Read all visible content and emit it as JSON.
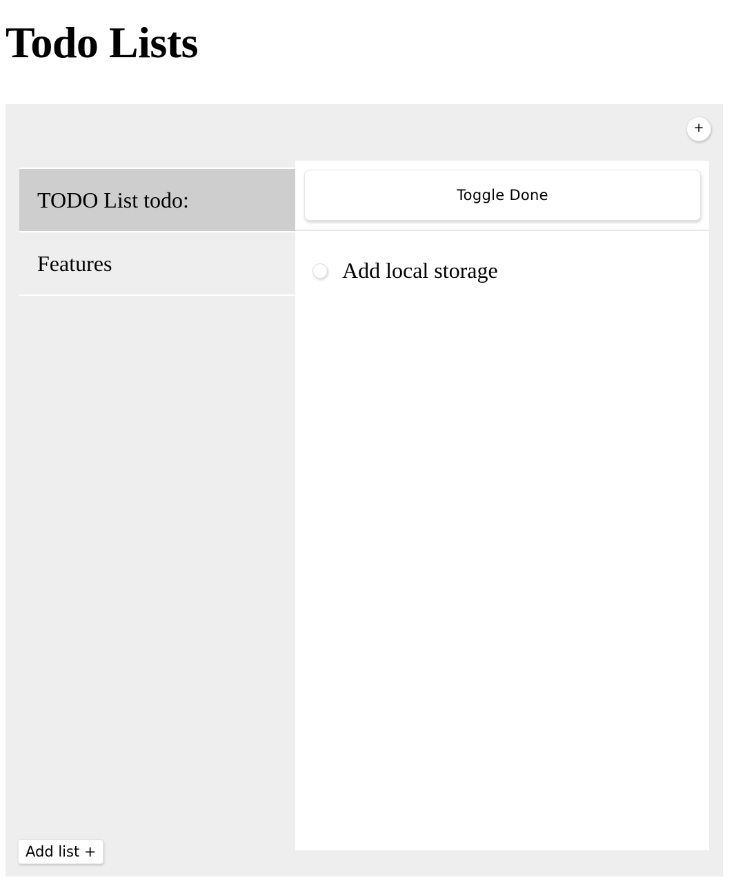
{
  "page": {
    "title": "Todo Lists"
  },
  "toolbar": {
    "add_item_label": "+"
  },
  "sidebar": {
    "items": [
      {
        "label": "TODO List todo:",
        "selected": true
      },
      {
        "label": "Features",
        "selected": false
      }
    ],
    "add_list_label": "Add list +"
  },
  "detail": {
    "toggle_done_label": "Toggle Done",
    "todos": [
      {
        "label": "Add local storage",
        "done": false
      }
    ]
  },
  "colors": {
    "panel_background": "#eeeeee",
    "selected_item_background": "#cecece",
    "detail_background": "#ffffff"
  }
}
